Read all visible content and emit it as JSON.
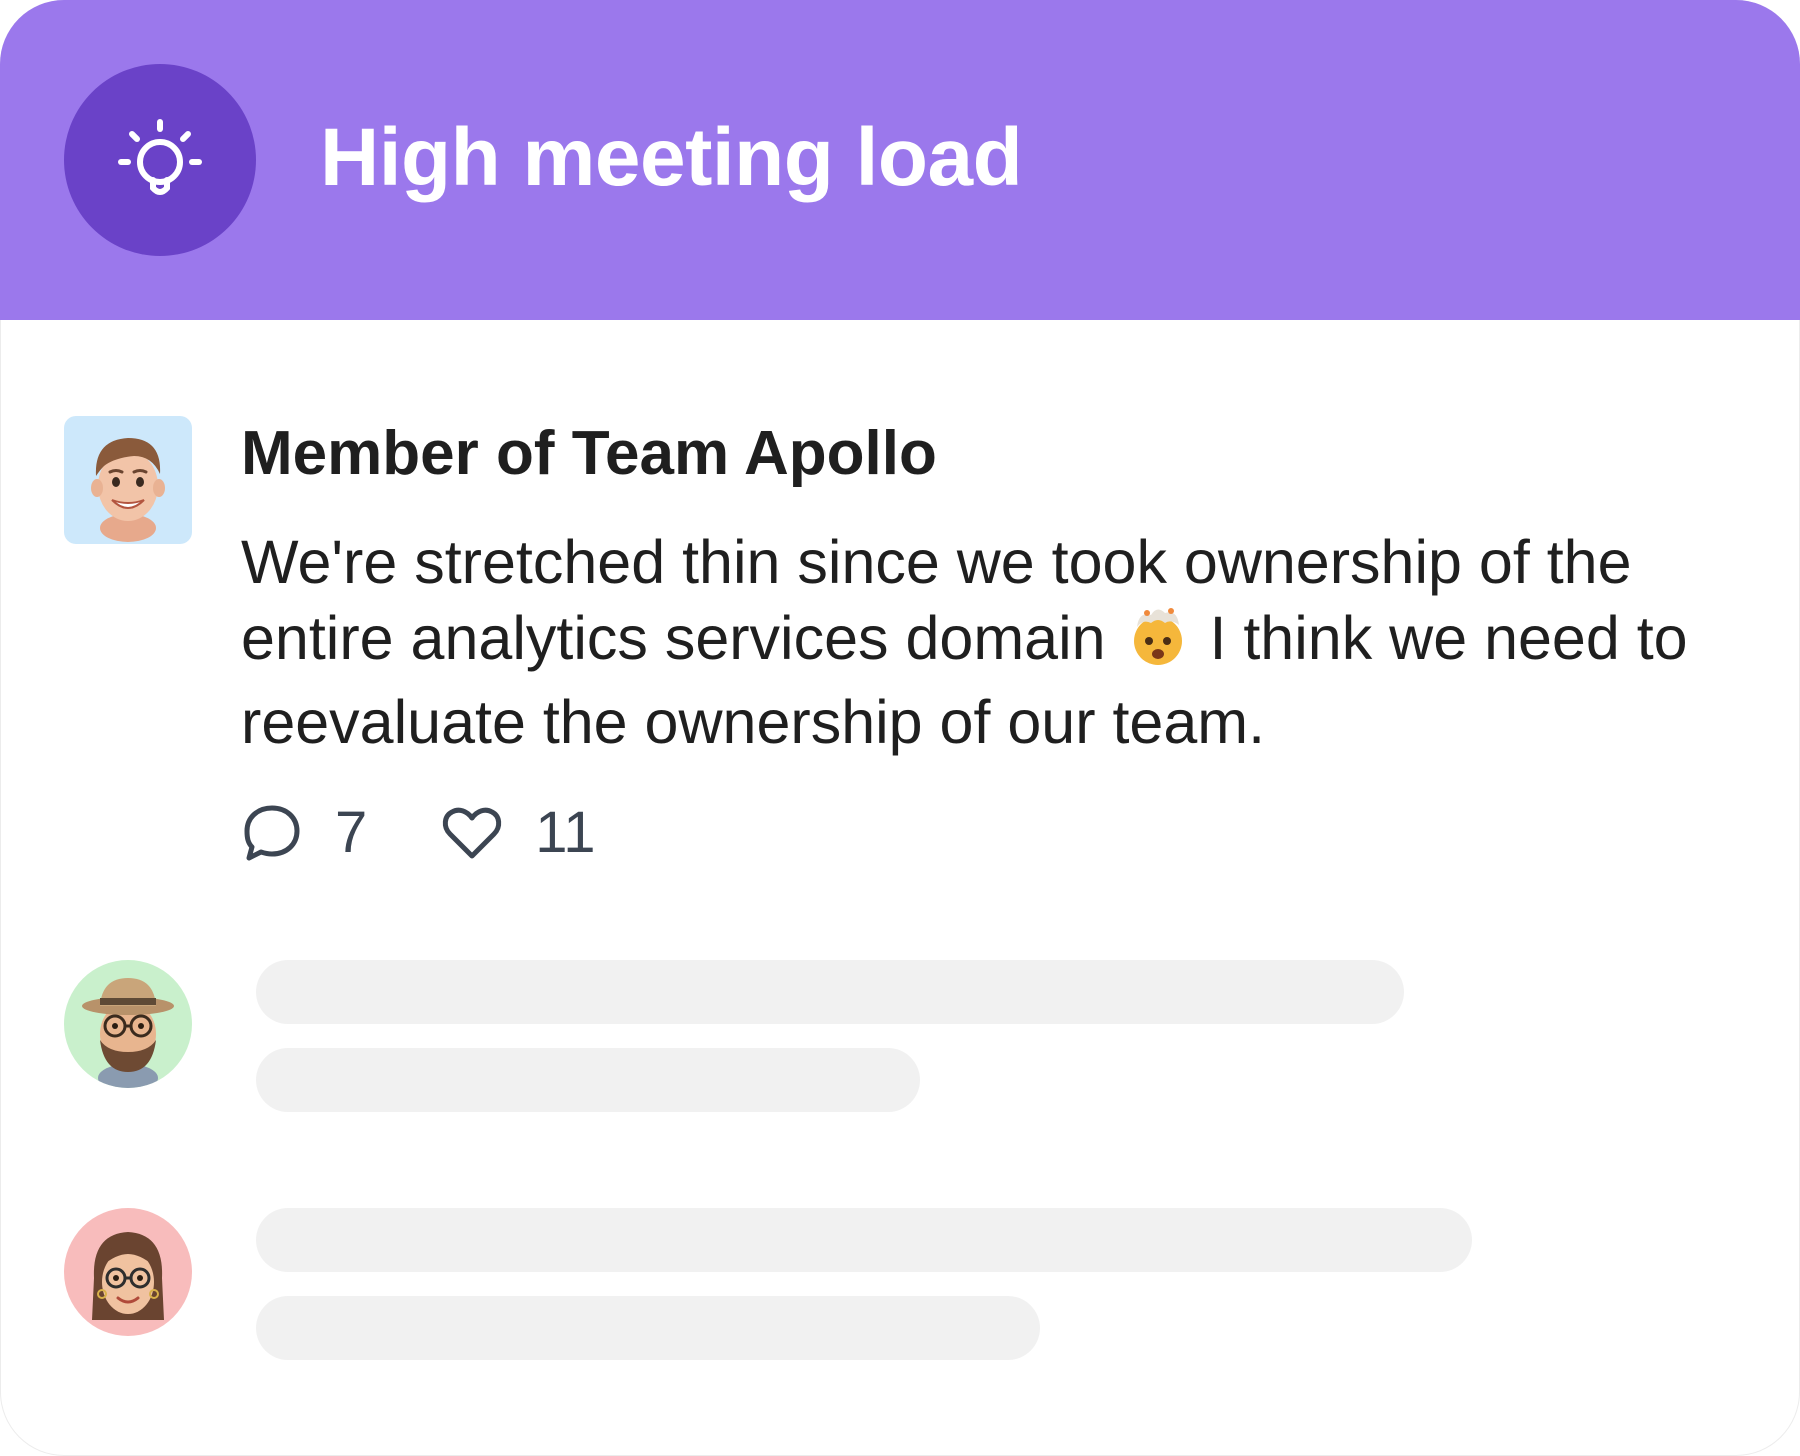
{
  "header": {
    "title": "High meeting load",
    "icon": "lightbulb-icon",
    "bg_color": "#9b78ec",
    "icon_bg_color": "#6a42c8"
  },
  "post": {
    "author": "Member of Team Apollo",
    "avatar": "memoji-man-avatar",
    "avatar_bg": "#cde8fb",
    "message_part1": "We're stretched thin since we took ownership of the entire analytics services domain",
    "message_emoji": "exploding-head-emoji",
    "message_part2": "I think we need to reevaluate the ownership of our team.",
    "comments_icon": "comment-icon",
    "comments_count": "7",
    "likes_icon": "heart-icon",
    "likes_count": "11"
  },
  "replies": [
    {
      "avatar": "memoji-bearded-man-hat-avatar",
      "avatar_bg": "#c9f0cc"
    },
    {
      "avatar": "memoji-woman-glasses-avatar",
      "avatar_bg": "#f8bcbc"
    }
  ]
}
